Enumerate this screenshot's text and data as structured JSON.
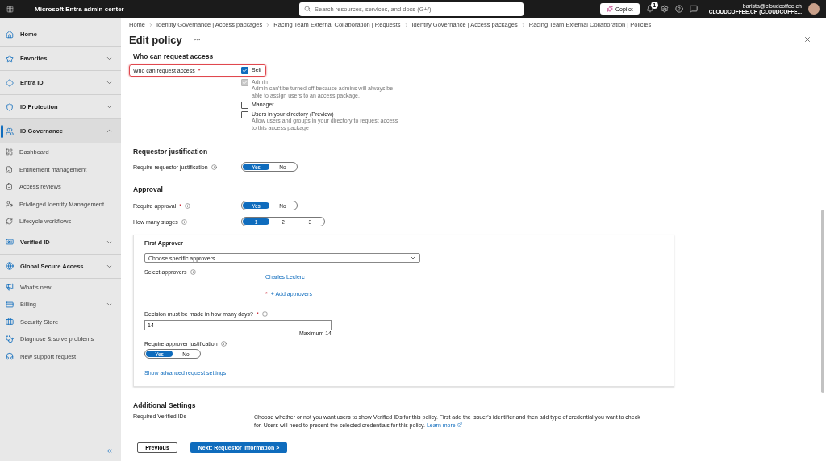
{
  "topbar": {
    "app_title": "Microsoft Entra admin center",
    "search_placeholder": "Search resources, services, and docs (G+/)",
    "copilot": "Copilot",
    "notification_count": "1",
    "user_email": "barista@cloudcoffee.ch",
    "user_tenant": "CLOUDCOFFEE.CH (CLOUDCOFFE..."
  },
  "sidebar": {
    "items": [
      {
        "label": "Home",
        "kind": "top",
        "selected": false
      },
      {
        "label": "Favorites",
        "kind": "section",
        "expanded": false,
        "selected": false
      },
      {
        "label": "Entra ID",
        "kind": "section",
        "expanded": false,
        "selected": false
      },
      {
        "label": "ID Protection",
        "kind": "section",
        "expanded": false,
        "selected": false
      },
      {
        "label": "ID Governance",
        "kind": "section",
        "expanded": true,
        "selected": true,
        "children": [
          {
            "label": "Dashboard"
          },
          {
            "label": "Entitlement management"
          },
          {
            "label": "Access reviews"
          },
          {
            "label": "Privileged Identity Management"
          },
          {
            "label": "Lifecycle workflows"
          }
        ]
      },
      {
        "label": "Verified ID",
        "kind": "section",
        "expanded": false,
        "selected": false
      },
      {
        "label": "Global Secure Access",
        "kind": "section",
        "expanded": false,
        "selected": false
      },
      {
        "label": "What's new",
        "kind": "link",
        "selected": false
      },
      {
        "label": "Billing",
        "kind": "link",
        "expanded": false,
        "selected": false
      },
      {
        "label": "Security Store",
        "kind": "link",
        "selected": false
      },
      {
        "label": "Diagnose & solve problems",
        "kind": "link",
        "selected": false
      },
      {
        "label": "New support request",
        "kind": "link",
        "selected": false
      }
    ]
  },
  "breadcrumbs": [
    "Home",
    "Identity Governance | Access packages",
    "Racing Team External Collaboration | Requests",
    "Identity Governance | Access packages",
    "Racing Team External Collaboration | Policies"
  ],
  "page_title": "Edit policy",
  "who_can_request": {
    "heading": "Who can request access",
    "label": "Who can request access",
    "required_mark": "*",
    "options": [
      {
        "label": "Self",
        "checked": true,
        "disabled": false
      },
      {
        "label": "Admin",
        "checked": true,
        "disabled": true,
        "description": "Admin can't be turned off because admins will always be able to assign users to an access package."
      },
      {
        "label": "Manager",
        "checked": false,
        "disabled": false
      },
      {
        "label": "Users in your directory (Preview)",
        "checked": false,
        "disabled": false,
        "description": "Allow users and groups in your directory to request access to this access package"
      }
    ]
  },
  "requestor_justification": {
    "heading": "Requestor justification",
    "label": "Require requestor justification",
    "options": [
      {
        "label": "Yes",
        "selected": true
      },
      {
        "label": "No",
        "selected": false
      }
    ]
  },
  "approval": {
    "heading": "Approval",
    "require_approval": {
      "label": "Require approval",
      "required_mark": "*",
      "options": [
        {
          "label": "Yes",
          "selected": true
        },
        {
          "label": "No",
          "selected": false
        }
      ]
    },
    "stages": {
      "label": "How many stages",
      "options": [
        {
          "label": "1",
          "selected": true
        },
        {
          "label": "2",
          "selected": false
        },
        {
          "label": "3",
          "selected": false
        }
      ]
    },
    "first_approver": {
      "heading": "First Approver",
      "dropdown": "Choose specific approvers",
      "select_label": "Select approvers",
      "approvers": [
        "Charles Leclerc"
      ],
      "add_required_mark": "*",
      "add_link": "+ Add approvers",
      "days_label": "Decision must be made in how many days?",
      "days_required_mark": "*",
      "days_value": "14",
      "days_hint": "Maximum 14",
      "justification_label": "Require approver justification",
      "justification_options": [
        {
          "label": "Yes",
          "selected": true
        },
        {
          "label": "No",
          "selected": false
        }
      ],
      "advanced_link": "Show advanced request settings"
    }
  },
  "additional": {
    "heading": "Additional Settings",
    "label": "Required Verified IDs",
    "description": "Choose whether or not you want users to show Verified IDs for this policy. First add the issuer's identifier and then add type of credential you want to check for. Users will need to present the selected credentials for this policy.",
    "learn_more": "Learn more"
  },
  "footer": {
    "previous": "Previous",
    "next": "Next: Requestor Information >"
  }
}
